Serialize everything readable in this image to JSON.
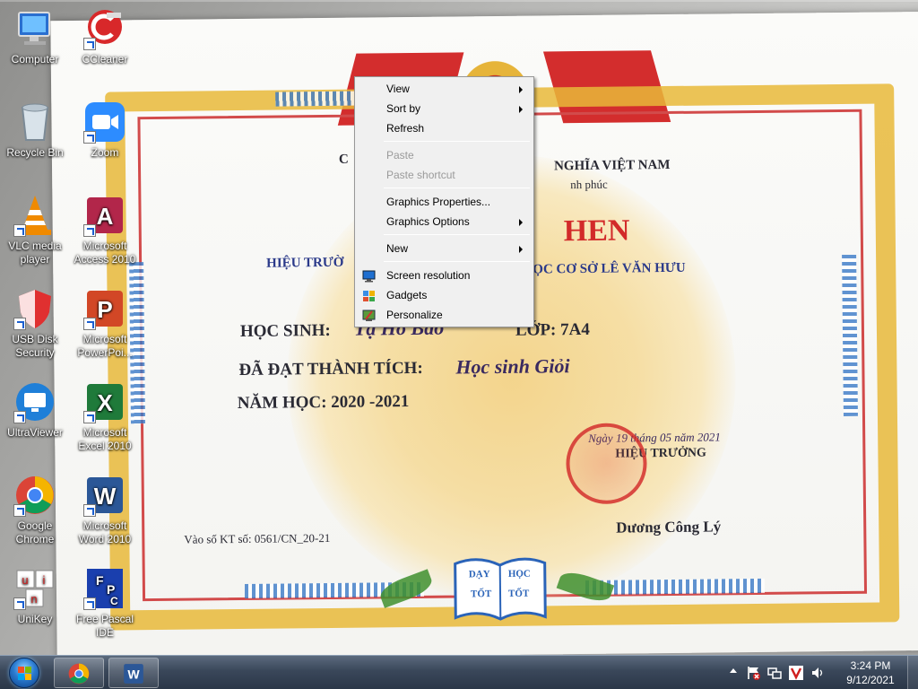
{
  "desktop": {
    "icons": [
      {
        "label": "Computer"
      },
      {
        "label": "CCleaner"
      },
      {
        "label": "Recycle Bin"
      },
      {
        "label": "Zoom"
      },
      {
        "label": "VLC media player"
      },
      {
        "label": "Microsoft Access 2010"
      },
      {
        "label": "USB Disk Security"
      },
      {
        "label": "Microsoft PowerPoi..."
      },
      {
        "label": "UltraViewer"
      },
      {
        "label": "Microsoft Excel 2010"
      },
      {
        "label": "Google Chrome"
      },
      {
        "label": "Microsoft Word 2010"
      },
      {
        "label": "UniKey"
      },
      {
        "label": "Free Pascal IDE"
      }
    ]
  },
  "wallpaper": {
    "line1": "C",
    "line2": "NGHĨA VIỆT NAM",
    "line3": "nh phúc",
    "title": "HEN",
    "school_left": "HIỆU TRƯỜ",
    "school_right": "ỌC CƠ SỞ LÊ VĂN HƯU",
    "student_label": "HỌC SINH:",
    "student_name": "Tạ Hồ Bảo",
    "class_label": "LỚP: 7A4",
    "achievement_label": "ĐÃ ĐẠT THÀNH TÍCH:",
    "achievement_value": "Học sinh Giỏi",
    "year": "NĂM HỌC: 2020 -2021",
    "date": "Ngày 19 tháng 05 năm 2021",
    "principal_title": "HIỆU TRƯỞNG",
    "principal_name": "Dương Công Lý",
    "registry": "Vào số KT số:  0561/CN_20-21",
    "book_left_1": "DẠY",
    "book_left_2": "TỐT",
    "book_right_1": "HỌC",
    "book_right_2": "TỐT"
  },
  "context_menu": {
    "items": [
      {
        "label": "View",
        "submenu": true
      },
      {
        "label": "Sort by",
        "submenu": true
      },
      {
        "label": "Refresh"
      },
      {
        "label": "Paste",
        "disabled": true
      },
      {
        "label": "Paste shortcut",
        "disabled": true
      },
      {
        "label": "Graphics Properties..."
      },
      {
        "label": "Graphics Options",
        "submenu": true
      },
      {
        "label": "New",
        "submenu": true
      },
      {
        "label": "Screen resolution",
        "icon": "monitor-icon"
      },
      {
        "label": "Gadgets",
        "icon": "gadgets-icon"
      },
      {
        "label": "Personalize",
        "icon": "personalize-icon"
      }
    ]
  },
  "taskbar": {
    "pinned": [
      {
        "icon": "chrome-icon"
      },
      {
        "icon": "word-icon"
      }
    ],
    "tray_icons": [
      "show-hidden-icons-arrow",
      "action-center-flag-icon",
      "network-icon",
      "vnc-icon",
      "volume-icon"
    ],
    "clock": {
      "time": "3:24 PM",
      "date": "9/12/2021"
    }
  },
  "colors": {
    "taskbar": "#2b3748",
    "menu_bg": "#f0f0f0",
    "certificate_gold": "#e8b93a",
    "certificate_red": "#d32d2d"
  }
}
